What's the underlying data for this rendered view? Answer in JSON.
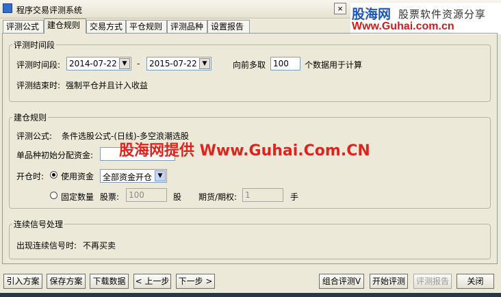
{
  "window": {
    "title": "程序交易评测系统",
    "close_glyph": "×"
  },
  "tabs": [
    "评测公式",
    "建仓规则",
    "交易方式",
    "平仓规则",
    "评测品种",
    "设置报告"
  ],
  "active_tab": 1,
  "watermark": {
    "logo_main": "股海网",
    "logo_tag": "股票软件资源分享",
    "logo_url": "Www.Guhai.com.cn",
    "center_text": "股海网提供 Www.Guhai.Com.CN"
  },
  "period": {
    "legend": "评测时间段",
    "label": "评测时间段:",
    "start": "2014-07-22",
    "dash": "-",
    "end": "2015-07-22",
    "lookback_label": "向前多取",
    "lookback_value": "100",
    "lookback_suffix": "个数据用于计算",
    "end_label": "评测结束时:",
    "end_value": "强制平仓并且计入收益"
  },
  "build": {
    "legend": "建仓规则",
    "formula_label": "评测公式:",
    "formula_value": "条件选股公式-(日线)-多空浪潮选股",
    "capital_label": "单品种初始分配资金:",
    "capital_value": "",
    "open_label": "开仓时:",
    "use_capital_label": "使用资金",
    "use_capital_option": "全部资金开仓",
    "fixed_qty_label": "固定数量",
    "stock_label": "股票:",
    "stock_qty": "100",
    "stock_unit": "股",
    "futures_label": "期货/期权:",
    "futures_qty": "1",
    "futures_unit": "手"
  },
  "signal": {
    "legend": "连续信号处理",
    "label": "出现连续信号时:",
    "value": "不再买卖"
  },
  "buttons": {
    "import": "引入方案",
    "save": "保存方案",
    "download": "下载数据",
    "prev": "< 上一步",
    "next": "下一步 >",
    "combo": "组合评测V",
    "start": "开始评测",
    "report": "评测报告",
    "close": "关闭"
  },
  "colors": {
    "logo_blue": "#1c56b8",
    "watermark_red": "#e0241d",
    "window_bg": "#ece9d8"
  }
}
